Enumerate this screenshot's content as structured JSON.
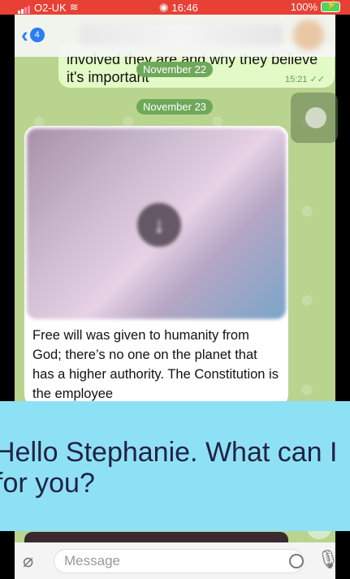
{
  "status_bar": {
    "carrier": "O2-UK",
    "time": "16:46",
    "battery": "100%"
  },
  "header": {
    "back_badge": "4"
  },
  "messages": {
    "top_text_line1": "involved they are and why they believe",
    "top_text_line2": "it's important",
    "top_time": "15:21",
    "media_caption": "Free will was given to humanity from God; there’s no one on the planet that has a higher authority. The Constitution is the employee"
  },
  "dates": {
    "first": "November 22",
    "second": "November 23"
  },
  "banner": {
    "line1": "Hello Stephanie. What can I",
    "line2": "for you?"
  },
  "input": {
    "placeholder": "Message"
  },
  "icons": {
    "back": "chevron-left-icon",
    "download": "download-arrow-icon",
    "attach": "paperclip-icon",
    "sticker": "sticker-icon",
    "mic": "microphone-icon"
  },
  "colors": {
    "accent": "#2d7cf6",
    "status_bar": "#e84035",
    "chat_bg": "#b9d48f",
    "outgoing_bubble": "#e3f9c6",
    "banner": "#8ee1f5"
  }
}
